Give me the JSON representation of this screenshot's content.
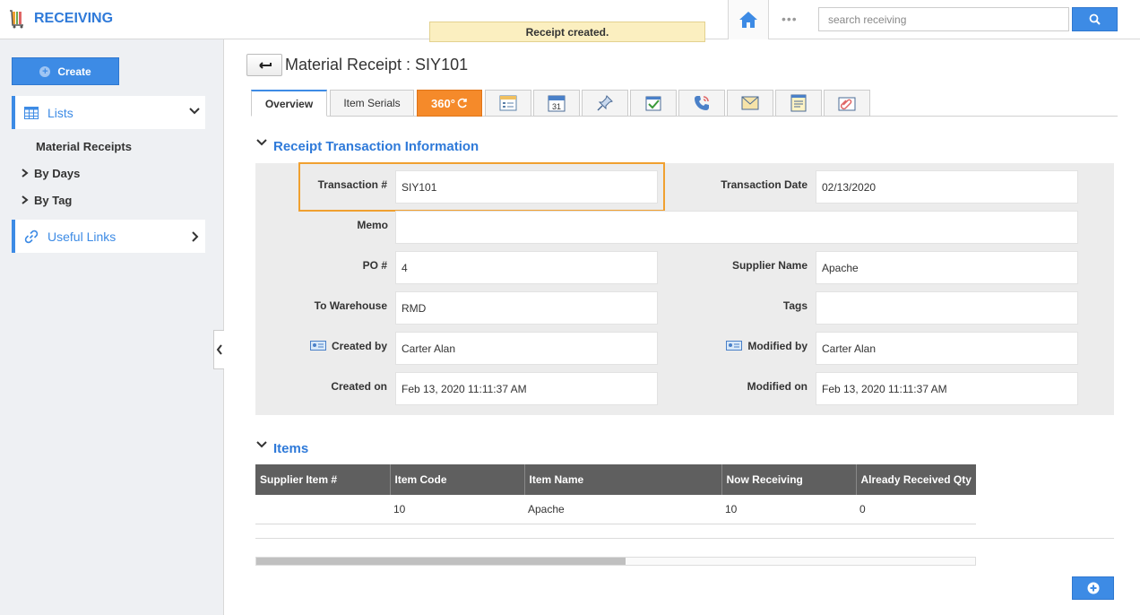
{
  "header": {
    "app_title": "RECEIVING",
    "toast": "Receipt created.",
    "search_placeholder": "search receiving",
    "more": "•••"
  },
  "sidebar": {
    "create_label": "Create",
    "lists_label": "Lists",
    "links": [
      "Material Receipts",
      "By Days",
      "By Tag"
    ],
    "useful_links_label": "Useful Links"
  },
  "page": {
    "title": "Material Receipt : SIY101"
  },
  "tabs": {
    "overview": "Overview",
    "item_serials": "Item Serials",
    "t360": "360°",
    "icons": [
      "list-card-icon",
      "calendar-icon",
      "pin-icon",
      "task-check-icon",
      "phone-icon",
      "email-icon",
      "notes-icon",
      "attachment-icon"
    ],
    "calendar_day": "31"
  },
  "receipt": {
    "section_title": "Receipt Transaction Information",
    "transaction_label": "Transaction #",
    "transaction": "SIY101",
    "transaction_date_label": "Transaction Date",
    "transaction_date": "02/13/2020",
    "memo_label": "Memo",
    "memo": "",
    "po_label": "PO #",
    "po": "4",
    "supplier_label": "Supplier Name",
    "supplier": "Apache",
    "warehouse_label": "To Warehouse",
    "warehouse": "RMD",
    "tags_label": "Tags",
    "tags": "",
    "created_by_label": "Created by",
    "created_by": "Carter Alan",
    "modified_by_label": "Modified by",
    "modified_by": "Carter Alan",
    "created_on_label": "Created on",
    "created_on": "Feb 13, 2020 11:11:37 AM",
    "modified_on_label": "Modified on",
    "modified_on": "Feb 13, 2020 11:11:37 AM"
  },
  "items": {
    "section_title": "Items",
    "columns": [
      "Supplier Item #",
      "Item Code",
      "Item Name",
      "Now Receiving",
      "Already Received Qty"
    ],
    "rows": [
      [
        "",
        "10",
        "Apache",
        "10",
        "0"
      ]
    ]
  },
  "colors": {
    "accent": "#3d8be5",
    "title_blue": "#2f7ad9",
    "toast_bg": "#fbefc0",
    "highlight": "#f0a030",
    "tab_360": "#f58a2a"
  }
}
